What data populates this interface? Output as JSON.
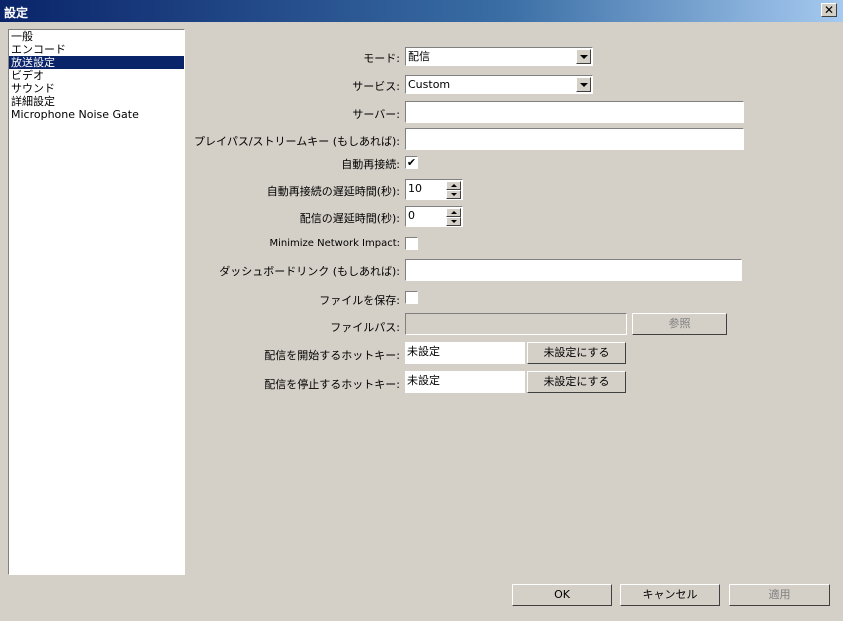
{
  "window": {
    "title": "設定",
    "close_glyph": "✕"
  },
  "categories": [
    {
      "label": "一般"
    },
    {
      "label": "エンコード"
    },
    {
      "label": "放送設定",
      "selected": true
    },
    {
      "label": "ビデオ"
    },
    {
      "label": "サウンド"
    },
    {
      "label": "詳細設定"
    },
    {
      "label": "Microphone Noise Gate"
    }
  ],
  "form": {
    "mode_label": "モード:",
    "mode_value": "配信",
    "service_label": "サービス:",
    "service_value": "Custom",
    "server_label": "サーバー:",
    "server_value": "",
    "playpath_label": "プレイパス/ストリームキー (もしあれば):",
    "playpath_value": "",
    "autoreconnect_label": "自動再接続:",
    "autoreconnect_checked": true,
    "reconnect_delay_label": "自動再接続の遅延時間(秒):",
    "reconnect_delay_value": "10",
    "stream_delay_label": "配信の遅延時間(秒):",
    "stream_delay_value": "0",
    "minimize_impact_label": "Minimize Network Impact:",
    "minimize_impact_checked": false,
    "dashboard_label": "ダッシュボードリンク (もしあれば):",
    "dashboard_value": "",
    "save_file_label": "ファイルを保存:",
    "save_file_checked": false,
    "file_path_label": "ファイルパス:",
    "file_path_value": "",
    "browse_label": "参照",
    "start_hotkey_label": "配信を開始するホットキー:",
    "start_hotkey_value": "未設定",
    "stop_hotkey_label": "配信を停止するホットキー:",
    "stop_hotkey_value": "未設定",
    "clear_hotkey_label": "未設定にする",
    "check_glyph": "✔"
  },
  "buttons": {
    "ok": "OK",
    "cancel": "キャンセル",
    "apply": "適用"
  }
}
